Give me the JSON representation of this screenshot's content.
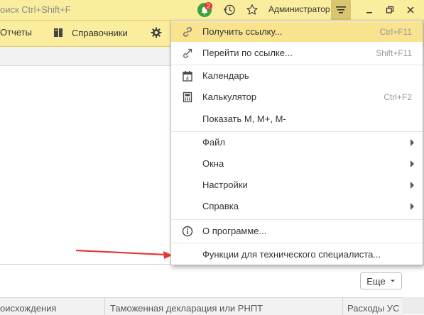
{
  "titlebar": {
    "search_placeholder": "оиск Ctrl+Shift+F",
    "notifications_count": "2",
    "user_name": "Администратор"
  },
  "toolbar": {
    "reports_label": "Отчеты",
    "references_label": "Справочники"
  },
  "menu": {
    "items": [
      {
        "label": "Получить ссылку...",
        "shortcut": "Ctrl+F11",
        "icon": "link-icon"
      },
      {
        "label": "Перейти по ссылке...",
        "shortcut": "Shift+F11",
        "icon": "follow-link-icon"
      },
      {
        "label": "Календарь",
        "shortcut": "",
        "icon": "calendar-icon"
      },
      {
        "label": "Калькулятор",
        "shortcut": "Ctrl+F2",
        "icon": "calculator-icon"
      },
      {
        "label": "Показать M, M+, M-",
        "shortcut": "",
        "icon": ""
      },
      {
        "label": "Файл",
        "shortcut": "",
        "icon": ""
      },
      {
        "label": "Окна",
        "shortcut": "",
        "icon": ""
      },
      {
        "label": "Настройки",
        "shortcut": "",
        "icon": ""
      },
      {
        "label": "Справка",
        "shortcut": "",
        "icon": ""
      },
      {
        "label": "О программе...",
        "shortcut": "",
        "icon": "info-icon"
      },
      {
        "label": "Функции для технического специалиста...",
        "shortcut": "",
        "icon": ""
      }
    ],
    "calendar_day": "4"
  },
  "content": {
    "more_label": "Еще"
  },
  "table": {
    "columns": [
      "оисхождения",
      "Таможенная декларация или РНПТ",
      "Расходы УС"
    ]
  },
  "colors": {
    "accent": "#fbed9e",
    "highlight": "#f9e38f",
    "badge": "#e53935",
    "annotation_arrow": "#e53935"
  }
}
